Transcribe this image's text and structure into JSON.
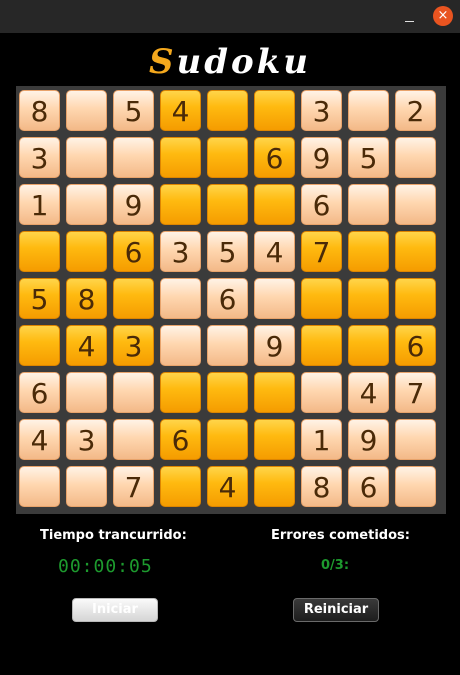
{
  "window": {
    "minimize_glyph": "_",
    "close_glyph": "×"
  },
  "app": {
    "logo_first": "S",
    "logo_rest": "udoku"
  },
  "board": [
    [
      "8",
      "",
      "5",
      "4",
      "",
      "",
      "3",
      "",
      "2"
    ],
    [
      "3",
      "",
      "",
      "",
      "",
      "6",
      "9",
      "5",
      ""
    ],
    [
      "1",
      "",
      "9",
      "",
      "",
      "",
      "6",
      "",
      ""
    ],
    [
      "",
      "",
      "6",
      "3",
      "5",
      "4",
      "7",
      "",
      ""
    ],
    [
      "5",
      "8",
      "",
      "",
      "6",
      "",
      "",
      "",
      ""
    ],
    [
      "",
      "4",
      "3",
      "",
      "",
      "9",
      "",
      "",
      "6"
    ],
    [
      "6",
      "",
      "",
      "",
      "",
      "",
      "",
      "4",
      "7"
    ],
    [
      "4",
      "3",
      "",
      "6",
      "",
      "",
      "1",
      "9",
      ""
    ],
    [
      "",
      "",
      "7",
      "",
      "4",
      "",
      "8",
      "6",
      ""
    ]
  ],
  "board_colors": [
    [
      "L",
      "L",
      "L",
      "O",
      "O",
      "O",
      "L",
      "L",
      "L"
    ],
    [
      "L",
      "L",
      "L",
      "O",
      "O",
      "O",
      "L",
      "L",
      "L"
    ],
    [
      "L",
      "L",
      "L",
      "O",
      "O",
      "O",
      "L",
      "L",
      "L"
    ],
    [
      "O",
      "O",
      "O",
      "L",
      "L",
      "L",
      "O",
      "O",
      "O"
    ],
    [
      "O",
      "O",
      "O",
      "L",
      "L",
      "L",
      "O",
      "O",
      "O"
    ],
    [
      "O",
      "O",
      "O",
      "L",
      "L",
      "L",
      "O",
      "O",
      "O"
    ],
    [
      "L",
      "L",
      "L",
      "O",
      "O",
      "O",
      "L",
      "L",
      "L"
    ],
    [
      "L",
      "L",
      "L",
      "O",
      "O",
      "O",
      "L",
      "L",
      "L"
    ],
    [
      "L",
      "L",
      "L",
      "O",
      "O",
      "O",
      "L",
      "L",
      "L"
    ]
  ],
  "colors": {
    "light_tile": "#ffd7b0",
    "orange_tile": "#ffba10",
    "digit": "#4a2a08",
    "status_green": "#1d9a2e",
    "logo_accent": "#f4a81d"
  },
  "stats": {
    "time_label": "Tiempo trancurrido:",
    "time_value": "00:00:05",
    "errors_label": "Errores cometidos:",
    "errors_value": "0/3:"
  },
  "buttons": {
    "start": "Iniciar",
    "reset": "Reiniciar"
  }
}
